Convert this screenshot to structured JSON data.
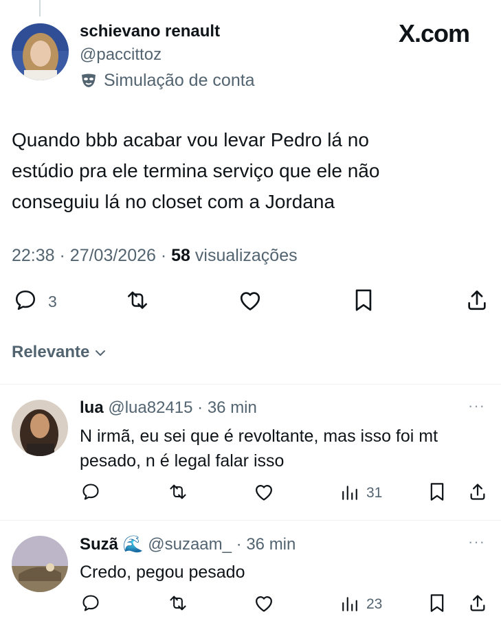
{
  "header": {
    "display_name": "schievano renault",
    "handle": "@paccittoz",
    "label": "Simulação de conta",
    "brand": "X.com"
  },
  "tweet": {
    "text_lines": [
      "Quando bbb acabar vou levar Pedro lá no",
      "estúdio pra ele termina serviço que ele não",
      "conseguiu lá no closet com a Jordana"
    ],
    "time": "22:38",
    "date": "27/03/2026",
    "views_count": "58",
    "views_label": "visualizações",
    "reply_count": "3"
  },
  "sort": {
    "label": "Relevante"
  },
  "replies": [
    {
      "name": "lua",
      "handle": "@lua82415",
      "time": "36 min",
      "text_lines": [
        "N irmã, eu sei que é revoltante, mas isso foi mt",
        "pesado, n é legal falar isso"
      ],
      "views": "31"
    },
    {
      "name": "Suzã",
      "emoji": "🌊",
      "handle": "@suzaam_",
      "time": "36 min",
      "text_lines": [
        "Credo, pegou pesado"
      ],
      "views": "23"
    }
  ],
  "icons": {
    "reply": "reply-icon",
    "retweet": "retweet-icon",
    "like": "heart-icon",
    "bookmark": "bookmark-icon",
    "share": "share-icon",
    "views": "views-icon",
    "more": "more-icon",
    "mask": "mask-icon",
    "chevron": "chevron-down-icon"
  },
  "colors": {
    "text": "#0f1419",
    "secondary": "#536471",
    "divider": "#eff3f4"
  }
}
